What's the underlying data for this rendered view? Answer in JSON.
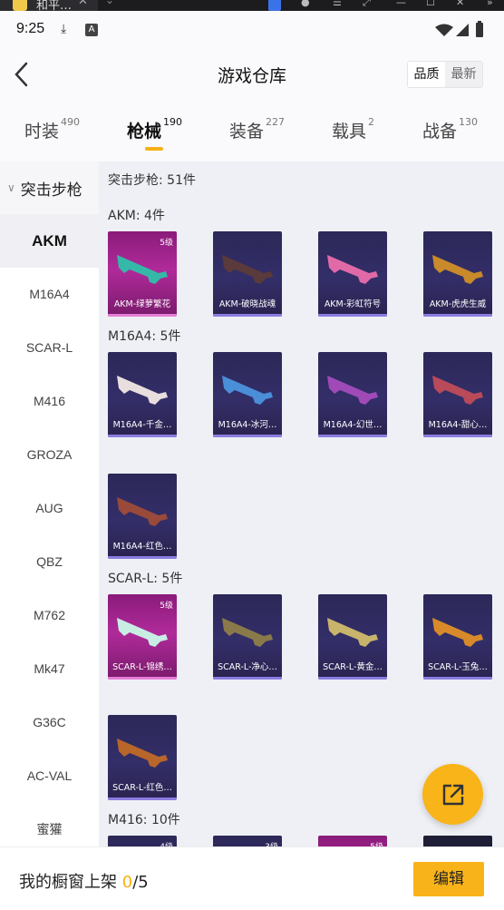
{
  "chrome": {
    "tab_title": "和平…",
    "tab_close": "✕"
  },
  "status": {
    "time": "9:25"
  },
  "header": {
    "title": "游戏仓库",
    "back_icon": "chevron-left-icon",
    "sort": [
      "品质",
      "最新"
    ]
  },
  "tabs": [
    {
      "label": "时装",
      "count": "490"
    },
    {
      "label": "枪械",
      "count": "190"
    },
    {
      "label": "装备",
      "count": "227"
    },
    {
      "label": "载具",
      "count": "2"
    },
    {
      "label": "战备",
      "count": "130"
    }
  ],
  "colors": {
    "accent": "#f7b017",
    "card_purple": "#2c2858",
    "card_gold": "#b02a9a"
  },
  "sidebar": {
    "group": "突击步枪",
    "items": [
      "AKM",
      "M16A4",
      "SCAR-L",
      "M416",
      "GROZA",
      "AUG",
      "QBZ",
      "M762",
      "Mk47",
      "G36C",
      "AC-VAL",
      "蜜獾"
    ]
  },
  "main": {
    "summary": "突击步枪: 51件",
    "groups": [
      {
        "title": "AKM: 4件",
        "items": [
          {
            "name": "AKM-绿萝繁花",
            "level": "5级"
          },
          {
            "name": "AKM-破晓战魂",
            "level": ""
          },
          {
            "name": "AKM-彩虹符号",
            "level": ""
          },
          {
            "name": "AKM-虎虎生威",
            "level": ""
          }
        ]
      },
      {
        "title": "M16A4: 5件",
        "items": [
          {
            "name": "M16A4-千金…",
            "level": ""
          },
          {
            "name": "M16A4-冰河…",
            "level": ""
          },
          {
            "name": "M16A4-幻世…",
            "level": ""
          },
          {
            "name": "M16A4-甜心…",
            "level": ""
          },
          {
            "name": "M16A4-红色…",
            "level": ""
          }
        ]
      },
      {
        "title": "SCAR-L: 5件",
        "items": [
          {
            "name": "SCAR-L-锦绣…",
            "level": "5级"
          },
          {
            "name": "SCAR-L-净心…",
            "level": ""
          },
          {
            "name": "SCAR-L-黄金…",
            "level": ""
          },
          {
            "name": "SCAR-L-玉兔…",
            "level": ""
          },
          {
            "name": "SCAR-L-红色…",
            "level": ""
          }
        ]
      },
      {
        "title": "M416: 10件",
        "items": [
          {
            "name": "",
            "level": "4级"
          },
          {
            "name": "",
            "level": "3级"
          },
          {
            "name": "",
            "level": "5级"
          },
          {
            "name": "",
            "level": ""
          }
        ]
      }
    ]
  },
  "bottom": {
    "shelf_label": "我的橱窗上架",
    "shelf_count": "0",
    "shelf_total": "/5",
    "edit": "编辑"
  },
  "fab": {
    "icon": "share-external-icon"
  }
}
